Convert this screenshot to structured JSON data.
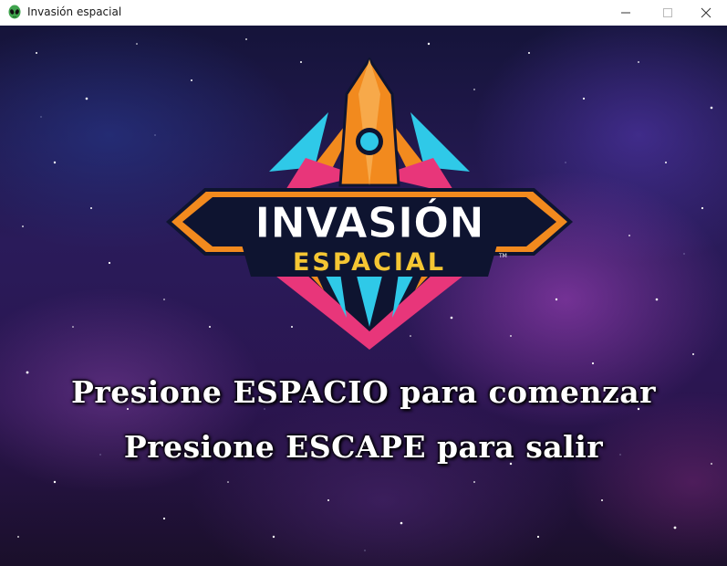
{
  "window": {
    "title": "Invasión espacial",
    "icon": "alien-icon"
  },
  "logo": {
    "line1": "INVASIÓN",
    "line2": "ESPACIAL",
    "trademark": "TM",
    "colors": {
      "orange": "#f28a1e",
      "cyan": "#2fc9e8",
      "pink": "#e8367a",
      "yellow": "#f5c633",
      "navy": "#0e1430"
    }
  },
  "prompts": {
    "start": "Presione ESPACIO para comenzar",
    "exit": "Presione ESCAPE para salir"
  }
}
